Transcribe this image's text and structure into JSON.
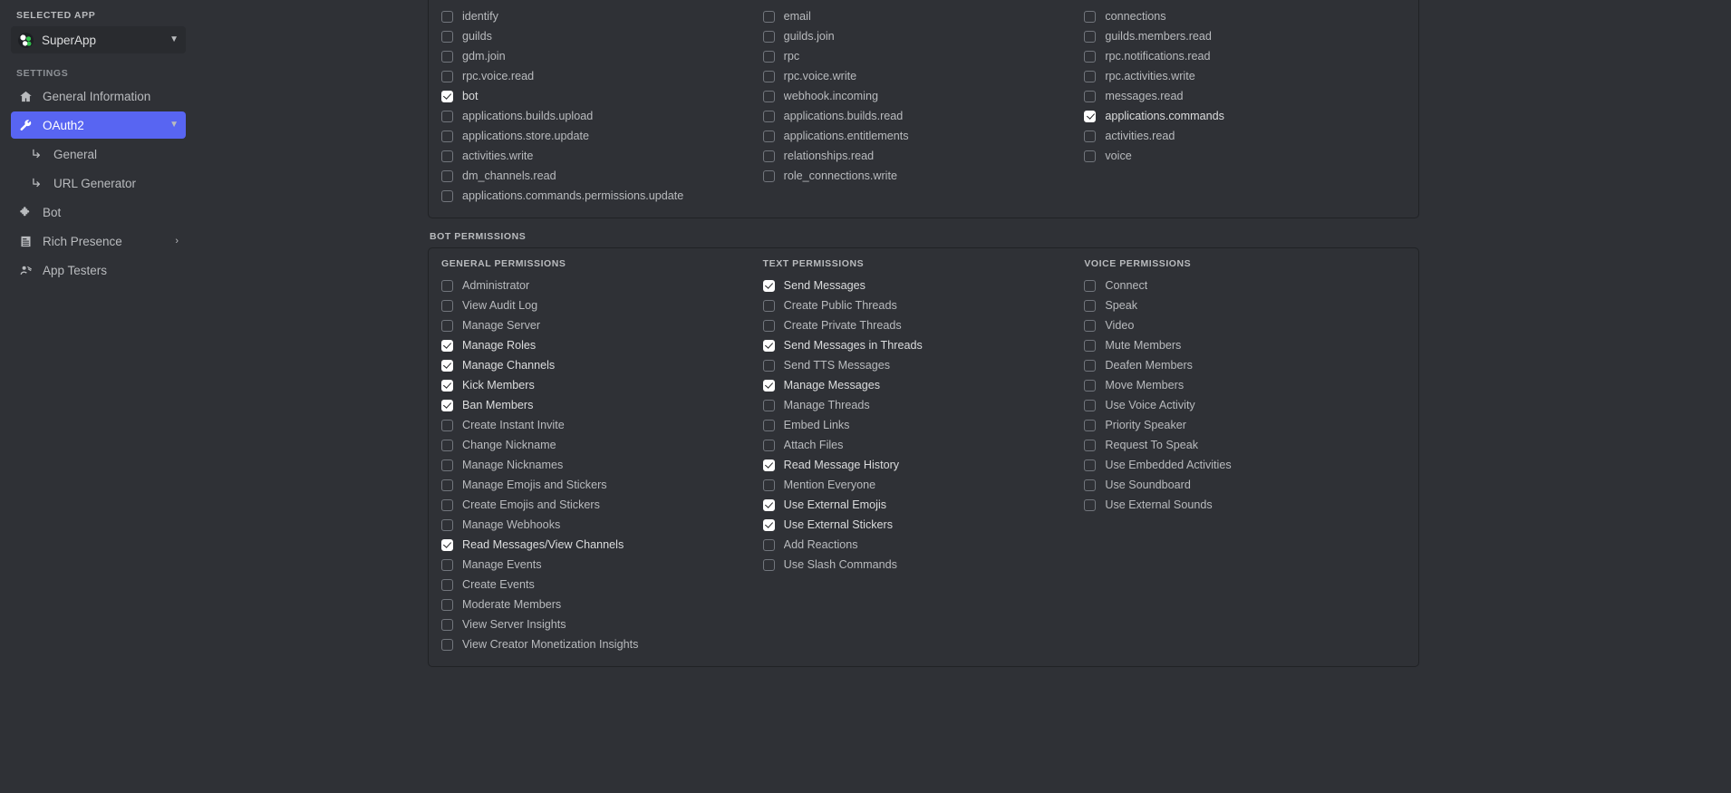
{
  "sidebar": {
    "selected_app_heading": "SELECTED APP",
    "app_name": "SuperApp",
    "app_avatar_icon": "app-avatar-icon",
    "app_chevron_icon": "chevron-down-icon",
    "settings_heading": "SETTINGS",
    "items": [
      {
        "label": "General Information",
        "icon": "home-icon",
        "active": false,
        "trailing": ""
      },
      {
        "label": "OAuth2",
        "icon": "wrench-icon",
        "active": true,
        "trailing": "chevron-down-icon"
      },
      {
        "label": "Bot",
        "icon": "puzzle-icon",
        "active": false,
        "trailing": ""
      },
      {
        "label": "Rich Presence",
        "icon": "document-icon",
        "active": false,
        "trailing": "chevron-right-icon"
      },
      {
        "label": "App Testers",
        "icon": "testers-icon",
        "active": false,
        "trailing": ""
      }
    ],
    "sub_items": [
      {
        "label": "General",
        "icon": "arrow-branch-icon"
      },
      {
        "label": "URL Generator",
        "icon": "arrow-branch-icon"
      }
    ]
  },
  "accent_color": "#5865f2",
  "scopes": {
    "columns": [
      [
        {
          "label": "identify",
          "checked": false
        },
        {
          "label": "guilds",
          "checked": false
        },
        {
          "label": "gdm.join",
          "checked": false
        },
        {
          "label": "rpc.voice.read",
          "checked": false
        },
        {
          "label": "bot",
          "checked": true
        },
        {
          "label": "applications.builds.upload",
          "checked": false
        },
        {
          "label": "applications.store.update",
          "checked": false
        },
        {
          "label": "activities.write",
          "checked": false
        },
        {
          "label": "dm_channels.read",
          "checked": false
        },
        {
          "label": "applications.commands.permissions.update",
          "checked": false
        }
      ],
      [
        {
          "label": "email",
          "checked": false
        },
        {
          "label": "guilds.join",
          "checked": false
        },
        {
          "label": "rpc",
          "checked": false
        },
        {
          "label": "rpc.voice.write",
          "checked": false
        },
        {
          "label": "webhook.incoming",
          "checked": false
        },
        {
          "label": "applications.builds.read",
          "checked": false
        },
        {
          "label": "applications.entitlements",
          "checked": false
        },
        {
          "label": "relationships.read",
          "checked": false
        },
        {
          "label": "role_connections.write",
          "checked": false
        }
      ],
      [
        {
          "label": "connections",
          "checked": false
        },
        {
          "label": "guilds.members.read",
          "checked": false
        },
        {
          "label": "rpc.notifications.read",
          "checked": false
        },
        {
          "label": "rpc.activities.write",
          "checked": false
        },
        {
          "label": "messages.read",
          "checked": false
        },
        {
          "label": "applications.commands",
          "checked": true
        },
        {
          "label": "activities.read",
          "checked": false
        },
        {
          "label": "voice",
          "checked": false
        }
      ]
    ]
  },
  "bot_permissions": {
    "heading": "BOT PERMISSIONS",
    "groups": [
      {
        "title": "GENERAL PERMISSIONS",
        "items": [
          {
            "label": "Administrator",
            "checked": false
          },
          {
            "label": "View Audit Log",
            "checked": false
          },
          {
            "label": "Manage Server",
            "checked": false
          },
          {
            "label": "Manage Roles",
            "checked": true
          },
          {
            "label": "Manage Channels",
            "checked": true
          },
          {
            "label": "Kick Members",
            "checked": true
          },
          {
            "label": "Ban Members",
            "checked": true
          },
          {
            "label": "Create Instant Invite",
            "checked": false
          },
          {
            "label": "Change Nickname",
            "checked": false
          },
          {
            "label": "Manage Nicknames",
            "checked": false
          },
          {
            "label": "Manage Emojis and Stickers",
            "checked": false
          },
          {
            "label": "Create Emojis and Stickers",
            "checked": false
          },
          {
            "label": "Manage Webhooks",
            "checked": false
          },
          {
            "label": "Read Messages/View Channels",
            "checked": true
          },
          {
            "label": "Manage Events",
            "checked": false
          },
          {
            "label": "Create Events",
            "checked": false
          },
          {
            "label": "Moderate Members",
            "checked": false
          },
          {
            "label": "View Server Insights",
            "checked": false
          },
          {
            "label": "View Creator Monetization Insights",
            "checked": false
          }
        ]
      },
      {
        "title": "TEXT PERMISSIONS",
        "items": [
          {
            "label": "Send Messages",
            "checked": true
          },
          {
            "label": "Create Public Threads",
            "checked": false
          },
          {
            "label": "Create Private Threads",
            "checked": false
          },
          {
            "label": "Send Messages in Threads",
            "checked": true
          },
          {
            "label": "Send TTS Messages",
            "checked": false
          },
          {
            "label": "Manage Messages",
            "checked": true
          },
          {
            "label": "Manage Threads",
            "checked": false
          },
          {
            "label": "Embed Links",
            "checked": false
          },
          {
            "label": "Attach Files",
            "checked": false
          },
          {
            "label": "Read Message History",
            "checked": true
          },
          {
            "label": "Mention Everyone",
            "checked": false
          },
          {
            "label": "Use External Emojis",
            "checked": true
          },
          {
            "label": "Use External Stickers",
            "checked": true
          },
          {
            "label": "Add Reactions",
            "checked": false
          },
          {
            "label": "Use Slash Commands",
            "checked": false
          }
        ]
      },
      {
        "title": "VOICE PERMISSIONS",
        "items": [
          {
            "label": "Connect",
            "checked": false
          },
          {
            "label": "Speak",
            "checked": false
          },
          {
            "label": "Video",
            "checked": false
          },
          {
            "label": "Mute Members",
            "checked": false
          },
          {
            "label": "Deafen Members",
            "checked": false
          },
          {
            "label": "Move Members",
            "checked": false
          },
          {
            "label": "Use Voice Activity",
            "checked": false
          },
          {
            "label": "Priority Speaker",
            "checked": false
          },
          {
            "label": "Request To Speak",
            "checked": false
          },
          {
            "label": "Use Embedded Activities",
            "checked": false
          },
          {
            "label": "Use Soundboard",
            "checked": false
          },
          {
            "label": "Use External Sounds",
            "checked": false
          }
        ]
      }
    ]
  }
}
